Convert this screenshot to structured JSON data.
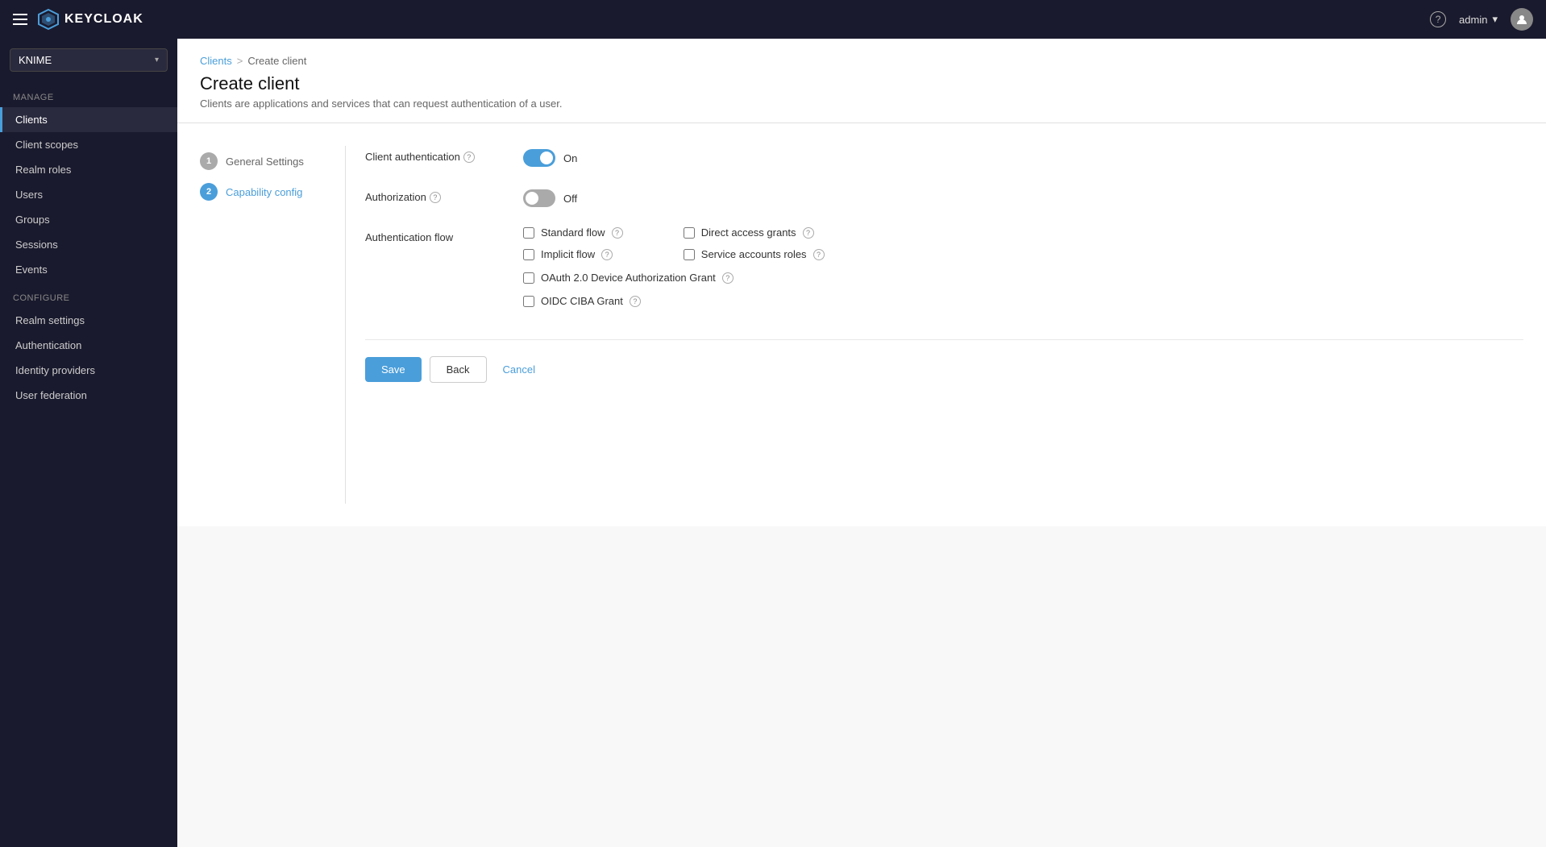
{
  "navbar": {
    "hamburger_label": "Menu",
    "logo_text": "KEYCLOAK",
    "help_label": "?",
    "user_label": "admin",
    "chevron": "▾"
  },
  "sidebar": {
    "realm": "KNIME",
    "chevron": "▾",
    "manage_label": "Manage",
    "items_manage": [
      {
        "id": "clients",
        "label": "Clients",
        "active": true
      },
      {
        "id": "client-scopes",
        "label": "Client scopes",
        "active": false
      },
      {
        "id": "realm-roles",
        "label": "Realm roles",
        "active": false
      },
      {
        "id": "users",
        "label": "Users",
        "active": false
      },
      {
        "id": "groups",
        "label": "Groups",
        "active": false
      },
      {
        "id": "sessions",
        "label": "Sessions",
        "active": false
      },
      {
        "id": "events",
        "label": "Events",
        "active": false
      }
    ],
    "configure_label": "Configure",
    "items_configure": [
      {
        "id": "realm-settings",
        "label": "Realm settings",
        "active": false
      },
      {
        "id": "authentication",
        "label": "Authentication",
        "active": false
      },
      {
        "id": "identity-providers",
        "label": "Identity providers",
        "active": false
      },
      {
        "id": "user-federation",
        "label": "User federation",
        "active": false
      }
    ]
  },
  "breadcrumb": {
    "parent": "Clients",
    "separator": ">",
    "current": "Create client"
  },
  "page": {
    "title": "Create client",
    "description": "Clients are applications and services that can request authentication of a user."
  },
  "wizard": {
    "steps": [
      {
        "number": "1",
        "label": "General Settings",
        "active": false
      },
      {
        "number": "2",
        "label": "Capability config",
        "active": true
      }
    ]
  },
  "form": {
    "client_auth": {
      "label": "Client authentication",
      "info": "?",
      "toggle_state": "on",
      "toggle_text": "On"
    },
    "authorization": {
      "label": "Authorization",
      "info": "?",
      "toggle_state": "off",
      "toggle_text": "Off"
    },
    "auth_flow": {
      "label": "Authentication flow",
      "checkboxes": [
        {
          "id": "standard-flow",
          "label": "Standard flow",
          "info": "?",
          "checked": false
        },
        {
          "id": "direct-access",
          "label": "Direct access grants",
          "info": "?",
          "checked": false
        },
        {
          "id": "implicit-flow",
          "label": "Implicit flow",
          "info": "?",
          "checked": false
        },
        {
          "id": "service-accounts",
          "label": "Service accounts roles",
          "info": "?",
          "checked": false
        }
      ],
      "checkboxes_full": [
        {
          "id": "oauth-device",
          "label": "OAuth 2.0 Device Authorization Grant",
          "info": "?",
          "checked": false
        },
        {
          "id": "oidc-ciba",
          "label": "OIDC CIBA Grant",
          "info": "?",
          "checked": false
        }
      ]
    },
    "actions": {
      "save": "Save",
      "back": "Back",
      "cancel": "Cancel"
    }
  }
}
